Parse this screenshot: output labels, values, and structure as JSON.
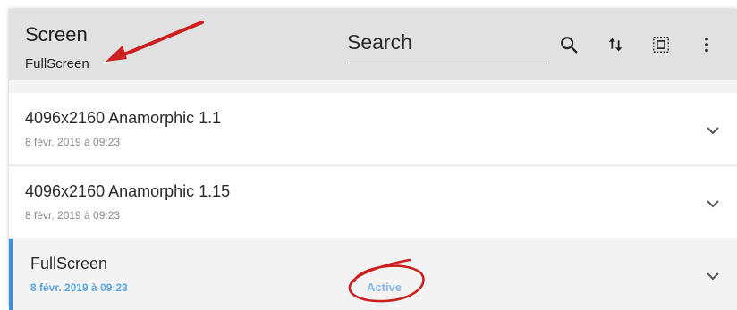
{
  "header": {
    "title": "Screen",
    "subtitle": "FullScreen",
    "search_placeholder": "Search",
    "icons": [
      "search-icon",
      "sort-icon",
      "select-all-icon",
      "more-vert-icon"
    ]
  },
  "items": [
    {
      "title": "4096x2160 Anamorphic 1.1",
      "date": "8 févr. 2019 à 09:23",
      "badge": ""
    },
    {
      "title": "4096x2160 Anamorphic 1.15",
      "date": "8 févr. 2019 à 09:23",
      "badge": ""
    },
    {
      "title": "FullScreen",
      "date": "8 févr. 2019 à 09:23",
      "badge": "Active"
    }
  ],
  "colors": {
    "accent": "#3d8fd6",
    "active_date": "#5aa9e6",
    "annotation": "#cc1f1f"
  }
}
